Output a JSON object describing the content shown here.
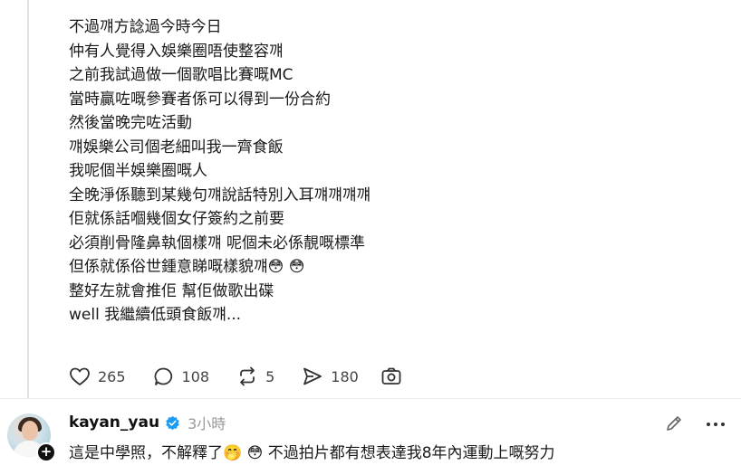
{
  "post": {
    "lines": [
      "不過꺠方諗過今時今日",
      "仲有人覺得入娛樂圈唔使整容꺠",
      "之前我試過做一個歌唱比賽嘅MC",
      "當時贏咗嘅參賽者係可以得到一份合約",
      "然後當晚完咗活動",
      "꺠娛樂公司個老細叫我一齊食飯",
      "我呢個半娛樂圈嘅人",
      "全晚淨係聽到某幾句꺠說話特別入耳꺠꺠꺠꺠",
      "佢就係話嗰幾個女仔簽約之前要",
      "必須削骨隆鼻執個樣꺠 呢個未必係靚嘅標準",
      "但係就係俗世鍾意睇嘅樣貌꺠😳 😳",
      "整好左就會推佢 幫佢做歌出碟",
      "well 我繼續低頭食飯꺠..."
    ]
  },
  "actions": {
    "likes": "265",
    "comments": "108",
    "reposts": "5",
    "shares": "180"
  },
  "reply": {
    "username": "kayan_yau",
    "time": "3小時",
    "text": "這是中學照，不解釋了🤭 😳 不過拍片都有想表達我8年內運動上嘅努力",
    "follow_symbol": "+"
  },
  "icons": {
    "like": "heart-icon",
    "comment": "comment-bubble-icon",
    "repost": "repost-icon",
    "share": "send-icon",
    "camera": "camera-icon",
    "verified": "verified-badge-icon",
    "edit": "pencil-icon",
    "more": "more-dots-icon"
  },
  "colors": {
    "verified_blue": "#1d9bf0",
    "muted_text": "#999999"
  }
}
